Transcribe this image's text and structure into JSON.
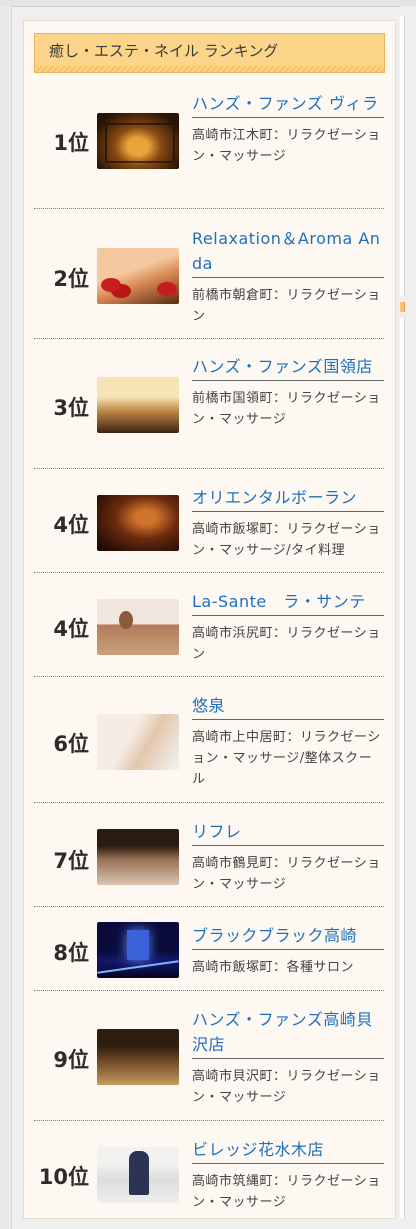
{
  "header": {
    "title": "癒し・エステ・ネイル ランキング"
  },
  "items": [
    {
      "rank": "1位",
      "name": "ハンズ・ファンズ ヴィラ",
      "desc": "高崎市江木町：リラクゼーション・マッサージ",
      "thumb_icon": "salon-photo"
    },
    {
      "rank": "2位",
      "name": "Relaxation＆Aroma Anda",
      "desc": "前橋市朝倉町：リラクゼーション",
      "thumb_icon": "salon-photo"
    },
    {
      "rank": "3位",
      "name": "ハンズ・ファンズ国領店",
      "desc": "前橋市国領町：リラクゼーション・マッサージ",
      "thumb_icon": "salon-photo"
    },
    {
      "rank": "4位",
      "name": "オリエンタルボーラン",
      "desc": "高崎市飯塚町：リラクゼーション・マッサージ/タイ料理",
      "thumb_icon": "salon-photo"
    },
    {
      "rank": "4位",
      "name": "La-Sante　ラ・サンテ",
      "desc": "高崎市浜尻町：リラクゼーション",
      "thumb_icon": "salon-photo"
    },
    {
      "rank": "6位",
      "name": "悠泉",
      "desc": "高崎市上中居町：リラクゼーション・マッサージ/整体スクール",
      "thumb_icon": "salon-photo"
    },
    {
      "rank": "7位",
      "name": "リフレ",
      "desc": "高崎市鶴見町：リラクゼーション・マッサージ",
      "thumb_icon": "salon-photo"
    },
    {
      "rank": "8位",
      "name": "ブラックブラック高崎",
      "desc": "高崎市飯塚町：各種サロン",
      "thumb_icon": "salon-photo"
    },
    {
      "rank": "9位",
      "name": "ハンズ・ファンズ高崎貝沢店",
      "desc": "高崎市貝沢町：リラクゼーション・マッサージ",
      "thumb_icon": "salon-photo"
    },
    {
      "rank": "10位",
      "name": "ビレッジ花水木店",
      "desc": "高崎市筑縄町：リラクゼーション・マッサージ",
      "thumb_icon": "salon-photo"
    }
  ]
}
